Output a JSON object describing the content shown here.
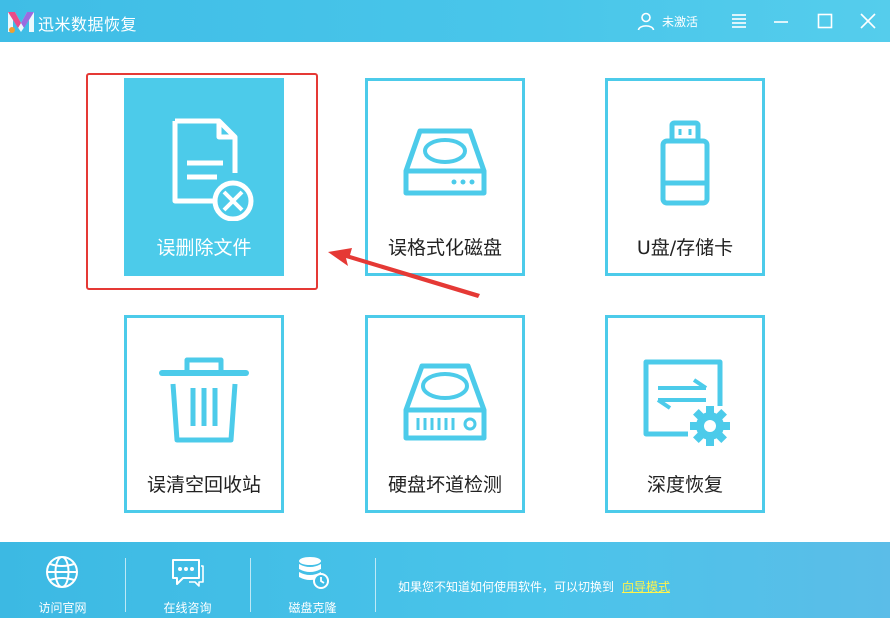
{
  "app": {
    "title": "迅米数据恢复",
    "user_label": "未激活"
  },
  "tiles": [
    {
      "label": "误删除文件",
      "icon": "deleted-file-icon",
      "active": true
    },
    {
      "label": "误格式化磁盘",
      "icon": "disk-drive-icon"
    },
    {
      "label": "U盘/存储卡",
      "icon": "usb-drive-icon"
    },
    {
      "label": "误清空回收站",
      "icon": "trash-can-icon"
    },
    {
      "label": "硬盘坏道检测",
      "icon": "hard-disk-icon"
    },
    {
      "label": "深度恢复",
      "icon": "deep-recovery-icon"
    }
  ],
  "footer": {
    "items": [
      {
        "label": "访问官网",
        "icon": "globe-icon"
      },
      {
        "label": "在线咨询",
        "icon": "chat-icon"
      },
      {
        "label": "磁盘克隆",
        "icon": "database-clone-icon"
      }
    ],
    "tip_text": "如果您不知道如何使用软件，可以切换到",
    "tip_link": "向导模式"
  },
  "colors": {
    "accent": "#4ccbea",
    "highlight": "#e53935",
    "link": "#fff34a"
  }
}
